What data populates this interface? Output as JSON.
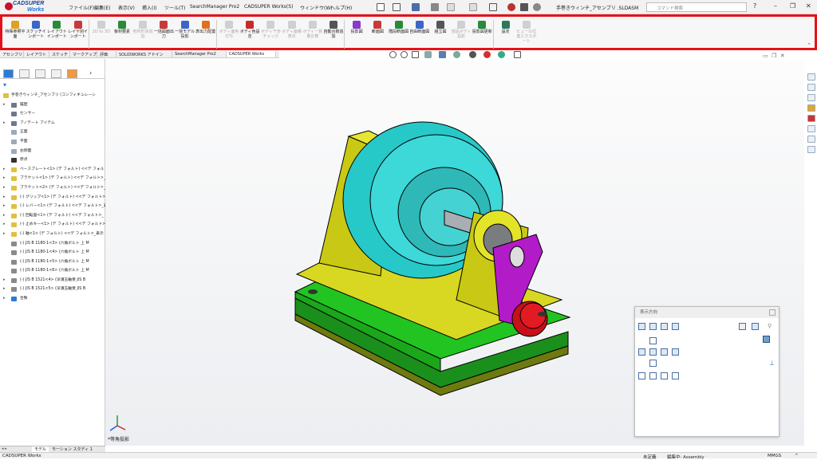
{
  "title_bar": {
    "logo_top": "CADSUPER",
    "logo_bottom": "Works",
    "menus": [
      "ファイル(F)",
      "編集(E)",
      "表示(V)",
      "挿入(I)",
      "ツール(T)",
      "SearchManager Pro2",
      "CADSUPER Works(S)",
      "ウィンドウ(W)",
      "ヘルプ(H)"
    ],
    "document_title": "手巻きウィンチ_アセンブリ .SLDASM",
    "search_placeholder": "コマンド検索",
    "window_controls": [
      "?",
      "–",
      "❐",
      "✕"
    ]
  },
  "command_manager": {
    "tools": [
      {
        "label": "特殊参照平面",
        "enabled": true,
        "color": "#e0a020"
      },
      {
        "label": "スケッチインポート",
        "enabled": true,
        "color": "#3a66c8"
      },
      {
        "label": "レイアウトインポート",
        "enabled": true,
        "color": "#2a8a3a"
      },
      {
        "label": "レイヤ別インポート",
        "enabled": true,
        "color": "#c83a3a"
      },
      {
        "label": "2D to 3D",
        "enabled": false,
        "color": "#888888"
      },
      {
        "label": "板材要素",
        "enabled": true,
        "color": "#2a8a3a"
      },
      {
        "label": "他所形状追加",
        "enabled": false,
        "color": "#888888"
      },
      {
        "label": "一括図面出力",
        "enabled": true,
        "color": "#c83a3a"
      },
      {
        "label": "一括モデル投影",
        "enabled": true,
        "color": "#3a66c8"
      },
      {
        "label": "表出力配置",
        "enabled": true,
        "color": "#e07020"
      },
      {
        "label": "ボディ面色付与",
        "enabled": false,
        "color": "#888888"
      },
      {
        "label": "ボディ色設定",
        "enabled": true,
        "color": "#c82a2a"
      },
      {
        "label": "ボディ干渉チェック",
        "enabled": false,
        "color": "#888888"
      },
      {
        "label": "ボディ面積表示",
        "enabled": false,
        "color": "#888888"
      },
      {
        "label": "ボディー質量計算",
        "enabled": false,
        "color": "#888888"
      },
      {
        "label": "自動合致追加",
        "enabled": true,
        "color": "#555555"
      },
      {
        "label": "投影図",
        "enabled": true,
        "color": "#8a3ac8"
      },
      {
        "label": "断面図",
        "enabled": true,
        "color": "#c83a3a"
      },
      {
        "label": "階段断面図",
        "enabled": true,
        "color": "#2a8a3a"
      },
      {
        "label": "自由断面図",
        "enabled": true,
        "color": "#3a66c8"
      },
      {
        "label": "組立図",
        "enabled": true,
        "color": "#555555"
      },
      {
        "label": "部品ボディ投影",
        "enabled": false,
        "color": "#888888"
      },
      {
        "label": "投影図更新",
        "enabled": true,
        "color": "#2a8a3a"
      },
      {
        "label": "設定",
        "enabled": true,
        "color": "#2a7a5a"
      },
      {
        "label": "ビューの位置エクスポート",
        "enabled": false,
        "color": "#888888"
      }
    ],
    "collapse": "⌃"
  },
  "tabs": [
    "アセンブリ",
    "レイアウト",
    "スケッチ",
    "マークアップ",
    "評価",
    "SOLIDWORKS アドイン",
    "SearchManager Pro2",
    "CADSUPER Works"
  ],
  "active_tab": "CADSUPER Works",
  "tree": {
    "root": "手巻きウィンチ_アセンブリ (コンフィギュレーシ",
    "nodes": [
      {
        "label": "履歴",
        "expand": "▸",
        "color": "#6a7a8a"
      },
      {
        "label": "センサー",
        "expand": "",
        "color": "#6a7a8a"
      },
      {
        "label": "アノテート アイテム",
        "expand": "▸",
        "color": "#6a7a8a"
      },
      {
        "label": "正面",
        "expand": "",
        "color": "#9aaaba"
      },
      {
        "label": "平面",
        "expand": "",
        "color": "#9aaaba"
      },
      {
        "label": "右側面",
        "expand": "",
        "color": "#9aaaba"
      },
      {
        "label": "原点",
        "expand": "",
        "color": "#333333"
      },
      {
        "label": "ベースプレート<1> (デ フォルト) <<デ フォルト>",
        "expand": "▸",
        "color": "#e0c040"
      },
      {
        "label": "ブラケット<1> (デ フォルト) <<デ フォルト>_表",
        "expand": "▸",
        "color": "#e0c040"
      },
      {
        "label": "ブラケット<2> (デ フォルト) <<デ フォルト>_表",
        "expand": "▸",
        "color": "#e0c040"
      },
      {
        "label": "(-) グリップ<1> (デ フォルト) <<デ フォルト>_",
        "expand": "▸",
        "color": "#e0c040"
      },
      {
        "label": "(-) レバー<1> (デ フォルト) <<デ フォルト>_表",
        "expand": "▸",
        "color": "#e0c040"
      },
      {
        "label": "(-) 回転盤<1> (デ フォルト) <<デ フォルト>_",
        "expand": "▸",
        "color": "#e0c040"
      },
      {
        "label": "(-) 止めキー<1> (デ フォルト) <<デ フォルト>_",
        "expand": "▸",
        "color": "#e0c040"
      },
      {
        "label": "(-) 軸<1> (デ フォルト) <<デ フォルト>_表示",
        "expand": "▸",
        "color": "#e0c040"
      },
      {
        "label": "(-) JIS B 1180-1<3> (六角ボルト 上 M",
        "expand": "",
        "color": "#8a8a8a"
      },
      {
        "label": "(-) JIS B 1180-1<4> (六角ボルト 上 M",
        "expand": "",
        "color": "#8a8a8a"
      },
      {
        "label": "(-) JIS B 1180-1<5> (六角ボルト 上 M",
        "expand": "",
        "color": "#8a8a8a"
      },
      {
        "label": "(-) JIS B 1180-1<6> (六角ボルト 上 M",
        "expand": "",
        "color": "#8a8a8a"
      },
      {
        "label": "(-) JIS B 1521<4> (深溝玉軸受 JIS B",
        "expand": "▸",
        "color": "#8a8a8a"
      },
      {
        "label": "(-) JIS B 1521<5> (深溝玉軸受 JIS B",
        "expand": "▸",
        "color": "#8a8a8a"
      },
      {
        "label": "合致",
        "expand": "▸",
        "color": "#2a7ad6"
      }
    ]
  },
  "bottom_tabs": [
    "モデル",
    "モーション スタディ 1"
  ],
  "viewport": {
    "view_label": "*等角投影"
  },
  "orientation_panel": {
    "title": "表示方向"
  },
  "status": {
    "app": "CADSUPER Works",
    "state": "未定義",
    "mode": "編集中: Assembly",
    "units": "MMGS"
  }
}
